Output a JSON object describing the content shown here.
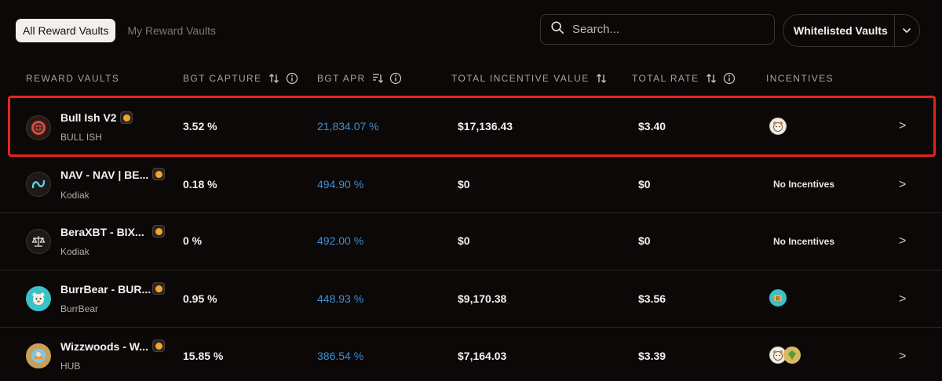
{
  "tabs": [
    {
      "label": "All Reward Vaults",
      "active": true
    },
    {
      "label": "My Reward Vaults",
      "active": false
    }
  ],
  "search": {
    "placeholder": "Search...",
    "icon": "search-icon"
  },
  "filter": {
    "label": "Whitelisted Vaults",
    "icon": "chevron-down-icon"
  },
  "columns": {
    "vaults": "REWARD VAULTS",
    "capture": "BGT CAPTURE",
    "apr": "BGT APR",
    "tiv": "TOTAL INCENTIVE VALUE",
    "rate": "TOTAL RATE",
    "incentives": "INCENTIVES"
  },
  "colors": {
    "accent_blue": "#3d8fd6",
    "highlight_red": "#e8231d",
    "background": "#0b0807"
  },
  "rows": [
    {
      "name": "Bull Ish V2",
      "sub": "BULL ISH",
      "capture": "3.52 %",
      "apr": "21,834.07 %",
      "tiv": "$17,136.43",
      "rate": "$3.40",
      "incentives": [
        "bear-face-icon"
      ],
      "no_incentives": "",
      "arrow": ">",
      "icon": "bull-ish-icon"
    },
    {
      "name": "NAV - NAV | BE...",
      "sub": "Kodiak",
      "capture": "0.18 %",
      "apr": "494.90 %",
      "tiv": "$0",
      "rate": "$0",
      "incentives": [],
      "no_incentives": "No Incentives",
      "arrow": ">",
      "icon": "nav-icon"
    },
    {
      "name": "BeraXBT - BIX...",
      "sub": "Kodiak",
      "capture": "0 %",
      "apr": "492.00 %",
      "tiv": "$0",
      "rate": "$0",
      "incentives": [],
      "no_incentives": "No Incentives",
      "arrow": ">",
      "icon": "scale-icon"
    },
    {
      "name": "BurrBear - BUR...",
      "sub": "BurrBear",
      "capture": "0.95 %",
      "apr": "448.93 %",
      "tiv": "$9,170.38",
      "rate": "$3.56",
      "incentives": [
        "burr-token-icon"
      ],
      "no_incentives": "",
      "arrow": ">",
      "icon": "burrbear-icon"
    },
    {
      "name": "Wizzwoods - W...",
      "sub": "HUB",
      "capture": "15.85 %",
      "apr": "386.54 %",
      "tiv": "$7,164.03",
      "rate": "$3.39",
      "incentives": [
        "bear-face-icon",
        "gem-icon"
      ],
      "no_incentives": "",
      "arrow": ">",
      "icon": "wizzwoods-icon"
    }
  ]
}
